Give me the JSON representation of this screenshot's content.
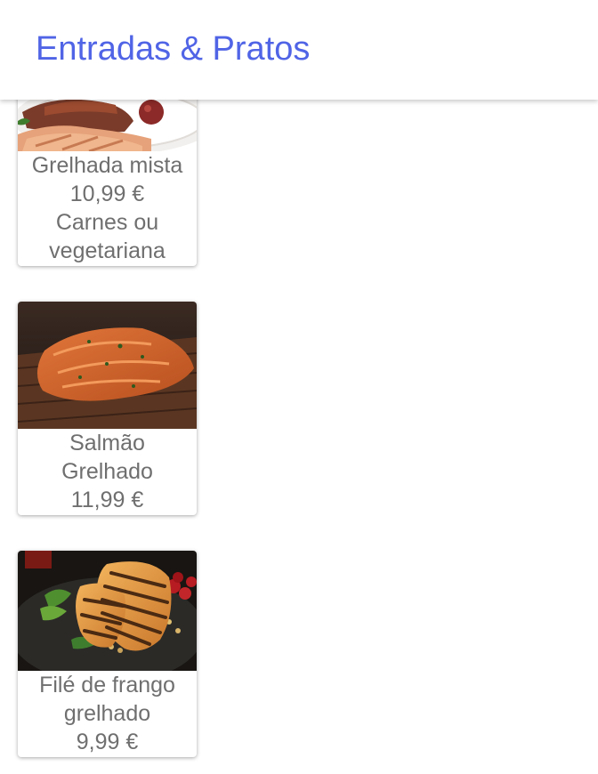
{
  "app_bar": {
    "title": "Entradas & Pratos",
    "accent_color": "#5064e6"
  },
  "menu": {
    "items": [
      {
        "name": "Grelhada mista",
        "price": "10,99 €",
        "description_lines": [
          "Carnes ou",
          "vegetariana"
        ],
        "image": "mixed-grill-photo"
      },
      {
        "name_lines": [
          "Salmão",
          "Grelhado"
        ],
        "price": "11,99 €",
        "image": "grilled-salmon-photo"
      },
      {
        "name_lines": [
          "Filé de frango",
          "grelhado"
        ],
        "price": "9,99 €",
        "image": "grilled-chicken-photo"
      }
    ]
  }
}
